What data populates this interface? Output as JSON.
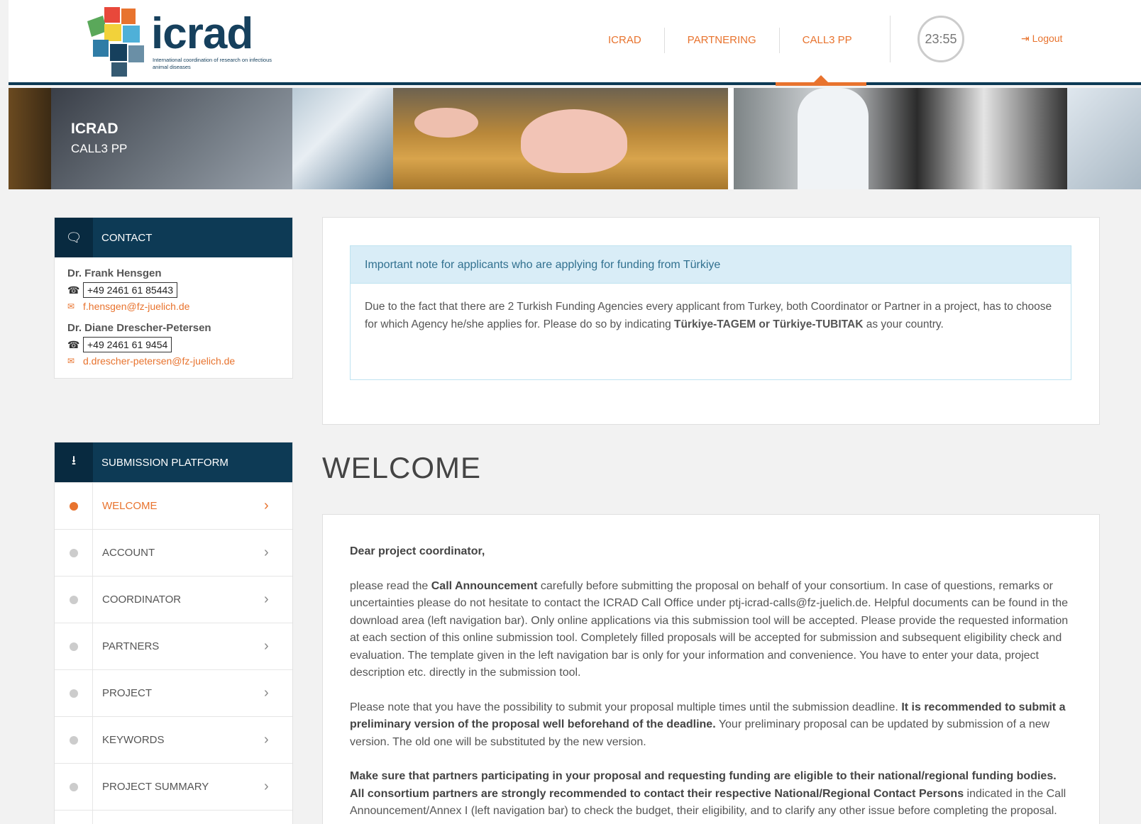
{
  "header": {
    "logo_word": "icrad",
    "logo_sub": "International coordination of research on infectious animal diseases",
    "nav": [
      "ICRAD",
      "PARTNERING",
      "CALL3 PP"
    ],
    "timer": "23:55",
    "logout": "Logout"
  },
  "banner": {
    "title": "ICRAD",
    "subtitle": "CALL3 PP"
  },
  "contact": {
    "title": "CONTACT",
    "persons": [
      {
        "name": "Dr. Frank Hensgen",
        "phone": "+49 2461 61 85443",
        "email": "f.hensgen@fz-juelich.de"
      },
      {
        "name": "Dr. Diane Drescher-Petersen",
        "phone": "+49 2461 61 9454",
        "email": "d.drescher-petersen@fz-juelich.de"
      }
    ]
  },
  "submission": {
    "title": "SUBMISSION PLATFORM",
    "items": [
      "WELCOME",
      "ACCOUNT",
      "COORDINATOR",
      "PARTNERS",
      "PROJECT",
      "KEYWORDS",
      "PROJECT SUMMARY"
    ],
    "active": "WELCOME"
  },
  "note": {
    "title": "Important note for applicants who are applying for funding from Türkiye",
    "body_pre": "Due to the fact that there are 2 Turkish Funding Agencies every applicant from Turkey, both Coordinator or Partner in a project, has to choose for which Agency he/she applies for. Please do so by indicating ",
    "body_bold": "Türkiye-TAGEM or Türkiye-TUBITAK",
    "body_post": " as your country."
  },
  "welcome": {
    "heading": "WELCOME",
    "greeting": "Dear project coordinator,",
    "p1_a": "please read the ",
    "p1_b": "Call Announcement",
    "p1_c": " carefully before submitting the proposal on behalf of your consortium. In case of questions, remarks or uncertainties please do not hesitate to contact the ICRAD Call Office under ptj-icrad-calls@fz-juelich.de. Helpful documents can be found in the download area (left navigation bar). Only online applications via this submission tool will be accepted. Please provide the requested information at each section of this online submission tool. Completely filled proposals will be accepted for submission and subsequent eligibility check and evaluation. The template given in the left navigation bar is only for your information and convenience. You have to enter your data, project description etc. directly in the submission tool.",
    "p2_a": "Please note that you have the possibility to submit your proposal multiple times until the submission deadline. ",
    "p2_b": "It is recommended to submit a preliminary version of the proposal well beforehand of the deadline.",
    "p2_c": " Your preliminary proposal can be updated by submission of a new version. The old one will be substituted by the new version.",
    "p3_a": "Make sure that partners participating in your proposal and requesting funding are eligible to their national/regional funding bodies. All consortium partners are strongly recommended to contact their respective National/Regional Contact Persons",
    "p3_b": " indicated in the Call Announcement/Annex I (left navigation bar) to check the budget, their eligibility, and to clarify any other issue before completing the proposal."
  }
}
